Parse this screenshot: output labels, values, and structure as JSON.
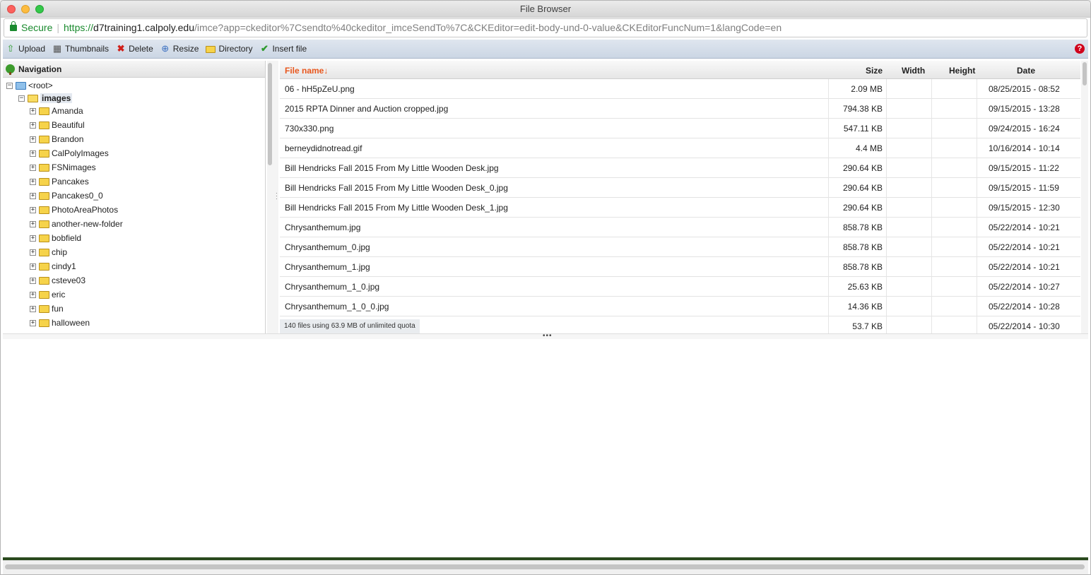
{
  "window": {
    "title": "File Browser"
  },
  "address": {
    "secure_label": "Secure",
    "scheme": "https://",
    "host": "d7training1.calpoly.edu",
    "path": "/imce?app=ckeditor%7Csendto%40ckeditor_imceSendTo%7C&CKEditor=edit-body-und-0-value&CKEditorFuncNum=1&langCode=en"
  },
  "toolbar": {
    "upload": "Upload",
    "thumbnails": "Thumbnails",
    "delete": "Delete",
    "resize": "Resize",
    "directory": "Directory",
    "insert": "Insert file",
    "help": "?"
  },
  "navigation": {
    "title": "Navigation",
    "root": "<root>",
    "images": "images",
    "folders": [
      "Amanda",
      "Beautiful",
      "Brandon",
      "CalPolyImages",
      "FSNimages",
      "Pancakes",
      "Pancakes0_0",
      "PhotoAreaPhotos",
      "another-new-folder",
      "bobfield",
      "chip",
      "cindy1",
      "csteve03",
      "eric",
      "fun",
      "halloween"
    ]
  },
  "files": {
    "columns": {
      "name": "File name↓",
      "size": "Size",
      "width": "Width",
      "height": "Height",
      "date": "Date"
    },
    "rows": [
      {
        "name": "06 - hH5pZeU.png",
        "size": "2.09 MB",
        "date": "08/25/2015 - 08:52"
      },
      {
        "name": "2015 RPTA Dinner and Auction cropped.jpg",
        "size": "794.38 KB",
        "date": "09/15/2015 - 13:28"
      },
      {
        "name": "730x330.png",
        "size": "547.11 KB",
        "date": "09/24/2015 - 16:24"
      },
      {
        "name": "berneydidnotread.gif",
        "size": "4.4 MB",
        "date": "10/16/2014 - 10:14"
      },
      {
        "name": "Bill Hendricks Fall 2015 From My Little Wooden Desk.jpg",
        "size": "290.64 KB",
        "date": "09/15/2015 - 11:22"
      },
      {
        "name": "Bill Hendricks Fall 2015 From My Little Wooden Desk_0.jpg",
        "size": "290.64 KB",
        "date": "09/15/2015 - 11:59"
      },
      {
        "name": "Bill Hendricks Fall 2015 From My Little Wooden Desk_1.jpg",
        "size": "290.64 KB",
        "date": "09/15/2015 - 12:30"
      },
      {
        "name": "Chrysanthemum.jpg",
        "size": "858.78 KB",
        "date": "05/22/2014 - 10:21"
      },
      {
        "name": "Chrysanthemum_0.jpg",
        "size": "858.78 KB",
        "date": "05/22/2014 - 10:21"
      },
      {
        "name": "Chrysanthemum_1.jpg",
        "size": "858.78 KB",
        "date": "05/22/2014 - 10:21"
      },
      {
        "name": "Chrysanthemum_1_0.jpg",
        "size": "25.63 KB",
        "date": "05/22/2014 - 10:27"
      },
      {
        "name": "Chrysanthemum_1_0_0.jpg",
        "size": "14.36 KB",
        "date": "05/22/2014 - 10:28"
      },
      {
        "name": "",
        "size": "53.7 KB",
        "date": "05/22/2014 - 10:30"
      }
    ],
    "status": "140 files using 63.9 MB of unlimited quota"
  }
}
